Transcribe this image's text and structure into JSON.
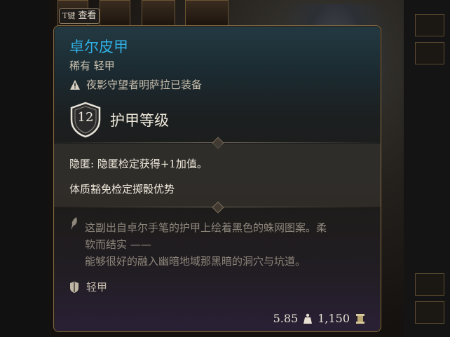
{
  "hotkey": {
    "key": "T键",
    "label": "查看"
  },
  "item": {
    "name": "卓尔皮甲",
    "subtitle": "稀有 轻甲",
    "equipped_by": "夜影守望者明萨拉已装备",
    "armor_class": "12",
    "armor_class_label": "护甲等级",
    "properties": [
      "隐匿: 隐匿检定获得+1加值。",
      "体质豁免检定掷骰优势"
    ],
    "description_line1": "这副出自卓尔手笔的护甲上绘着黑色的蛛网图案。柔",
    "description_line2": "软而结实 ——",
    "description_line3": "能够很好的融入幽暗地域那黑暗的洞穴与坑道。",
    "type": "轻甲",
    "weight": "5.85",
    "value": "1,150"
  },
  "icons": {
    "warning": "warning-icon",
    "shield": "armor-class-shield-icon",
    "description": "quill-icon",
    "armor_type": "light-armor-icon",
    "weight": "weight-icon",
    "gold": "gold-icon"
  },
  "colors": {
    "title": "#2fb1e6",
    "border": "#7f6a45",
    "text": "#efe9dc",
    "muted": "#8e877b"
  }
}
